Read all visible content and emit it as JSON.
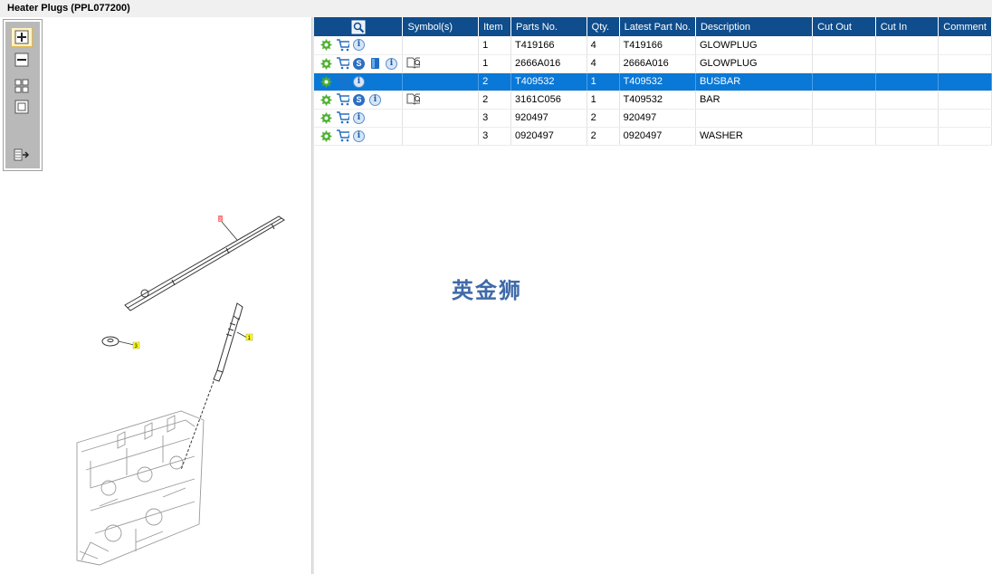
{
  "window": {
    "title": "Heater Plugs (PPL077200)"
  },
  "zoom_toolbar": {
    "buttons": [
      "zoom-in",
      "zoom-out",
      "fit-all",
      "fit-window",
      "panel-toggle"
    ]
  },
  "diagram": {
    "callouts": [
      {
        "label": "1",
        "part": "glowplug"
      },
      {
        "label": "2",
        "part": "busbar"
      },
      {
        "label": "3",
        "part": "washer"
      }
    ]
  },
  "grid": {
    "columns": [
      "",
      "Symbol(s)",
      "Item",
      "Parts No.",
      "Qty.",
      "Latest Part No.",
      "Description",
      "Cut Out",
      "Cut In",
      "Comment"
    ],
    "rows": [
      {
        "icons": [
          "gear-icon",
          "cart-icon",
          "info-icon"
        ],
        "symbol": "",
        "item": "1",
        "part_no": "T419166",
        "qty": "4",
        "latest": "T419166",
        "desc": "GLOWPLUG",
        "cut_out": "",
        "cut_in": "",
        "comment": ""
      },
      {
        "icons": [
          "gear-icon",
          "cart-icon",
          "s-icon",
          "book-icon",
          "info-icon"
        ],
        "symbol": "book-search-icon",
        "item": "1",
        "part_no": "2666A016",
        "qty": "4",
        "latest": "2666A016",
        "desc": "GLOWPLUG",
        "cut_out": "",
        "cut_in": "",
        "comment": ""
      },
      {
        "icons": [
          "gear-icon",
          "cart-icon",
          "info-icon"
        ],
        "symbol": "",
        "item": "2",
        "part_no": "T409532",
        "qty": "1",
        "latest": "T409532",
        "desc": "BUSBAR",
        "cut_out": "",
        "cut_in": "",
        "comment": "",
        "selected": true
      },
      {
        "icons": [
          "gear-icon",
          "cart-icon",
          "s-icon",
          "info-icon"
        ],
        "symbol": "book-search-icon",
        "item": "2",
        "part_no": "3161C056",
        "qty": "1",
        "latest": "T409532",
        "desc": "BAR",
        "cut_out": "",
        "cut_in": "",
        "comment": ""
      },
      {
        "icons": [
          "gear-icon",
          "cart-icon",
          "info-icon"
        ],
        "symbol": "",
        "item": "3",
        "part_no": "920497",
        "qty": "2",
        "latest": "920497",
        "desc": "",
        "cut_out": "",
        "cut_in": "",
        "comment": ""
      },
      {
        "icons": [
          "gear-icon",
          "cart-icon",
          "info-icon"
        ],
        "symbol": "",
        "item": "3",
        "part_no": "0920497",
        "qty": "2",
        "latest": "0920497",
        "desc": "WASHER",
        "cut_out": "",
        "cut_in": "",
        "comment": ""
      }
    ]
  },
  "watermark": {
    "text": "英金狮"
  },
  "colors": {
    "header": "#0f4d8c",
    "selected_row": "#0a78d7",
    "gear": "#4caf2e",
    "cart": "#2a6fc0"
  }
}
